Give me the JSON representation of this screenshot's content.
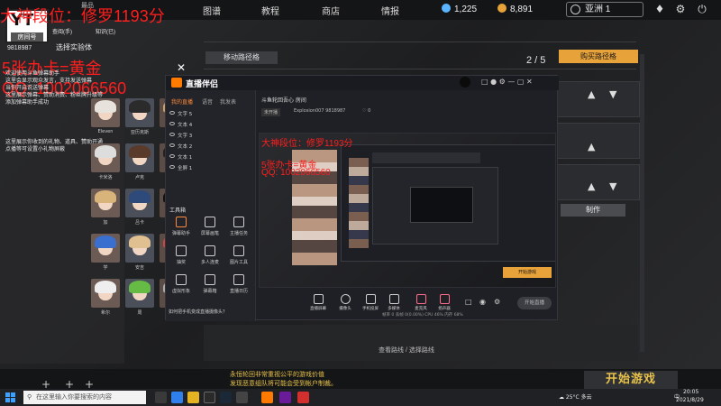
{
  "topbar": {
    "nav": [
      "图谱",
      "教程",
      "商店",
      "情报"
    ],
    "water_currency": "1,225",
    "coin_currency": "8,891",
    "region": "亚洲 1"
  },
  "overlay": {
    "title_rank": "大神段位：修罗1193分",
    "rank_faded": "最品",
    "room_badge_logo": "YT",
    "room_badge_label": "房间号",
    "room_number": "9818987",
    "experiment": "选择实验体",
    "tab_labels": [
      "查阅(手)",
      "知识(已)"
    ],
    "promo": "5张办卡=黄金",
    "qq": "QQ: 1002066560",
    "assist_lines": [
      "欢迎使用斗鱼弹幕助手",
      "这里会显示观众发言，支持发送弹幕",
      "当你开启说送弹幕",
      "这里展示弹幕、赞助消费、粉丝牌升级等",
      "添加弹幕助手成功"
    ],
    "gift_lines": [
      "这里展示你收到的礼物、道具、赞助开通",
      "点播等可设置小礼物屏蔽"
    ]
  },
  "characters": [
    {
      "name": "Eleven"
    },
    {
      "name": "亚历克斯"
    },
    {
      "name": "伯莱克默"
    },
    {
      "name": "伯尼克斯"
    },
    {
      "name": "卡米洛"
    },
    {
      "name": "卢克"
    },
    {
      "name": "加尔"
    },
    {
      "name": "后里"
    },
    {
      "name": "加"
    },
    {
      "name": "吕卡"
    },
    {
      "name": "亚当"
    },
    {
      "name": "方"
    },
    {
      "name": "学"
    },
    {
      "name": "安吉"
    },
    {
      "name": "空"
    },
    {
      "name": "尼"
    },
    {
      "name": "希尔"
    },
    {
      "name": "周"
    },
    {
      "name": "曼"
    },
    {
      "name": "法"
    }
  ],
  "streaming_app": {
    "name": "直播伴侣",
    "tabs": [
      "我的直播",
      "语音",
      "我发表"
    ],
    "scenes_title": "场景",
    "layers": [
      "文字 5",
      "文本 4",
      "文字 3",
      "文本 2",
      "文本 1",
      "全屏 1"
    ],
    "tools_header": "工具箱",
    "tools": [
      "弹幕助手",
      "屏幕画笔",
      "主播任务",
      "抽奖",
      "多人连麦",
      "图片工具",
      "虚拟形象",
      "弹幕箱",
      "直播日历"
    ],
    "hint": "如何把手机变成直播摄像头？",
    "channel_line": "斗鱼轮回吾心   房间",
    "header_status": "未开播",
    "user_line": "Explosion007  9818987",
    "like_count": "0",
    "bottom_tools": [
      "直播屏幕",
      "摄像头",
      "手机投屏",
      "多媒体",
      "麦克风",
      "扬声器"
    ],
    "go_live": "开始直播",
    "stats": "帧率 0   丢帧 0(0.00%)   CPU 46%   内存 68%"
  },
  "game_ui": {
    "move_button": "移动路径格",
    "page_indicator": "2 / 5",
    "orange_button": "购买路径格",
    "make_button": "制作",
    "bottom_hint": "查看路线 / 选择路线",
    "bottom_notice_1": "永恒轮回非常重视公平的游戏价值",
    "bottom_notice_2": "发现恶意组队将可能会受到帐户制裁。",
    "start_button": "开始游戏"
  },
  "taskbar": {
    "search_placeholder": "在这里输入你要搜索的内容",
    "weather": "25°C 多云",
    "time": "20:05",
    "date": "2021/8/29",
    "ime": "中"
  },
  "colors": {
    "accent_orange": "#e8a23a",
    "overlay_red": "#ff1e1e",
    "app_orange": "#ff7a00",
    "notice_yellow": "#e8c24a"
  }
}
